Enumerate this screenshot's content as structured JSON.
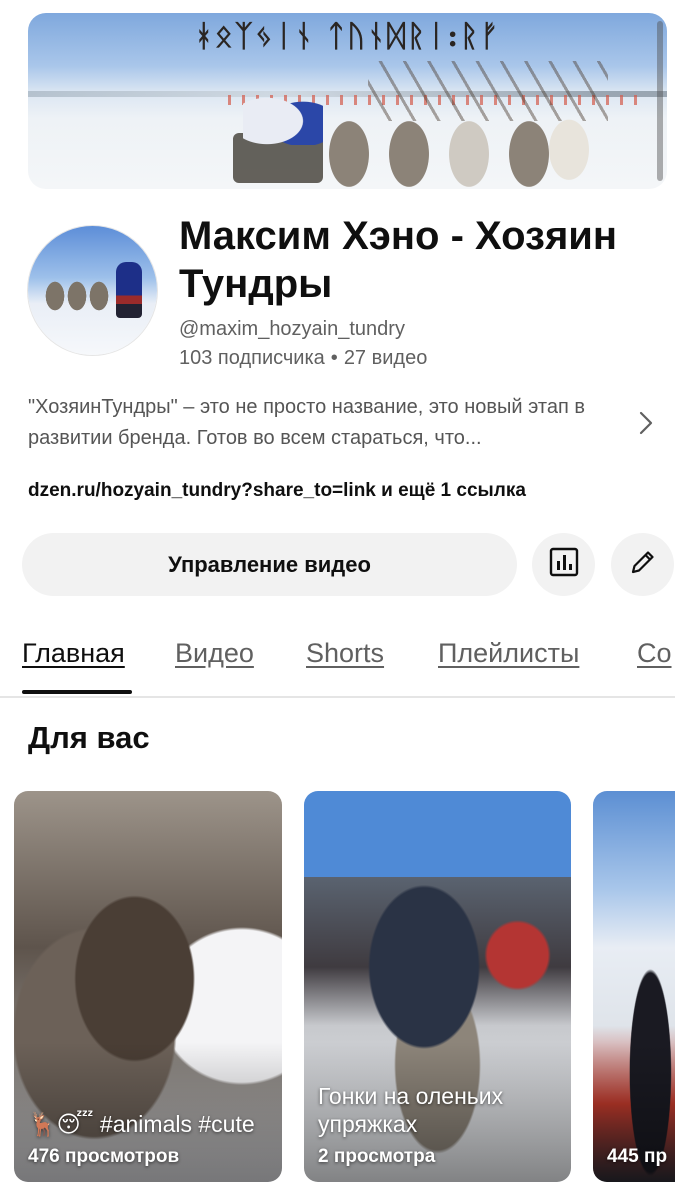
{
  "banner": {
    "title": "ᚼᛟᛉᛃᛁᚾ ᛏᚢᚾᛞᚱᛁ:ᚱᚠ"
  },
  "channel": {
    "name": "Максим Хэно - Хозяин Тундры",
    "handle": "@maxim_hozyain_tundry",
    "subscribers": "103 подписчика",
    "separator": "•",
    "videos": "27 видео",
    "description": "\"ХозяинТундры\" – это не просто название, это новый этап в развитии бренда. Готов во всем стараться, что...",
    "links": "dzen.ru/hozyain_tundry?share_to=link и ещё 1 ссылка"
  },
  "actions": {
    "manage_label": "Управление видео",
    "stats_icon": "bar-chart-icon",
    "edit_icon": "pencil-icon"
  },
  "tabs": [
    {
      "label": "Главная",
      "active": true
    },
    {
      "label": "Видео"
    },
    {
      "label": "Shorts"
    },
    {
      "label": "Плейлисты"
    },
    {
      "label": "Со"
    }
  ],
  "section": {
    "title": "Для вас"
  },
  "cards": [
    {
      "title": "🦌😴 #animals #cute",
      "views": "476 просмотров"
    },
    {
      "title": "Гонки на оленьих упряжках",
      "views": "2 просмотра"
    },
    {
      "title": "",
      "views": "445 пр"
    }
  ],
  "colors": {
    "text": "#0f0f0f",
    "secondary": "#606060",
    "button_bg": "#f2f2f2"
  }
}
